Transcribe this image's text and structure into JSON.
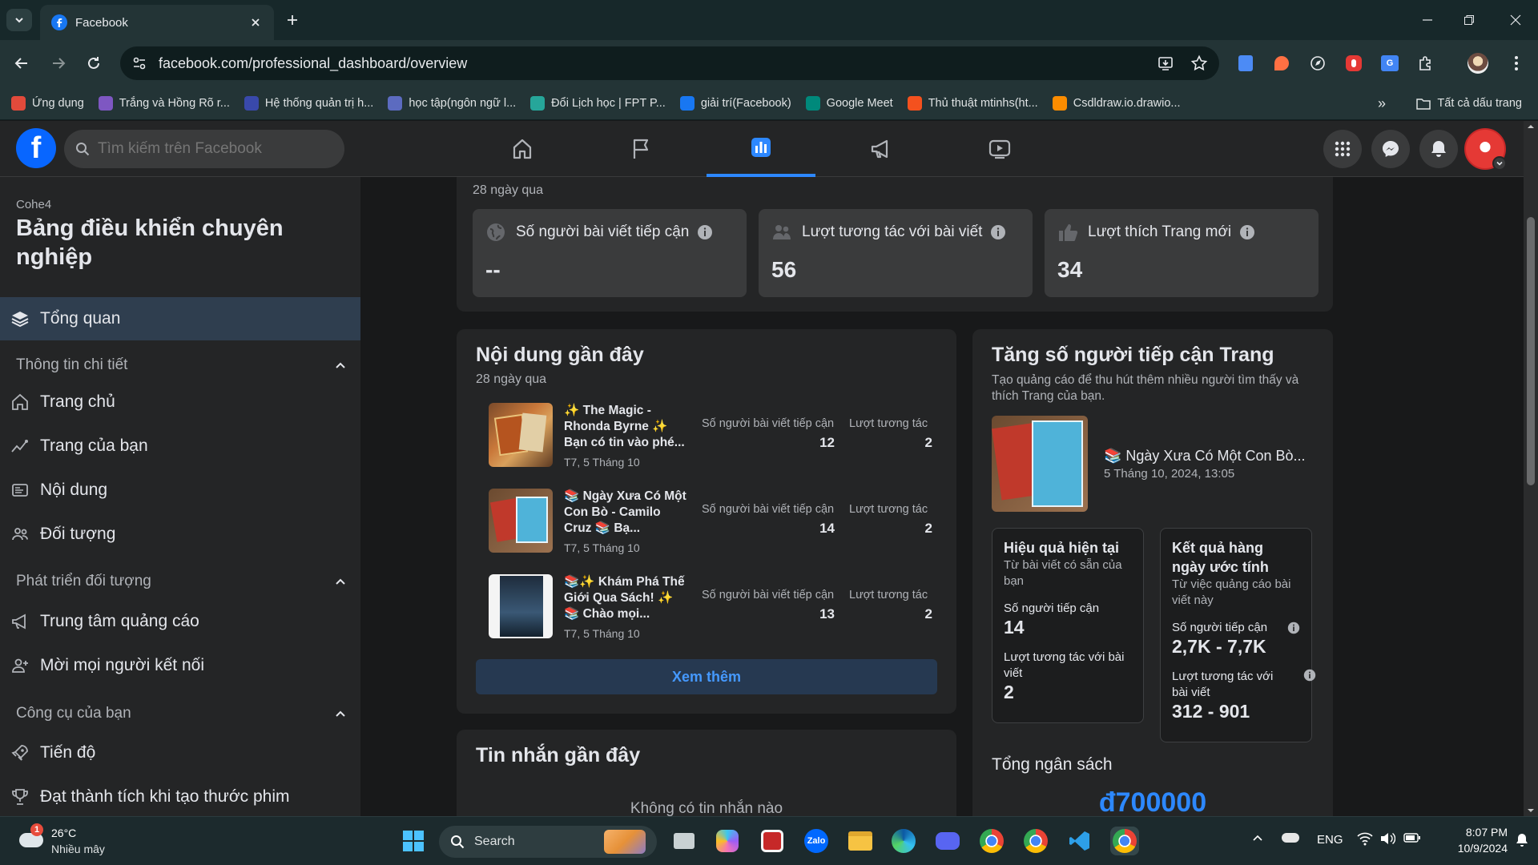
{
  "browser": {
    "tab_title": "Facebook",
    "url": "facebook.com/professional_dashboard/overview",
    "bookmarks": [
      {
        "label": "Ứng dụng",
        "color": "#e24a3b"
      },
      {
        "label": "Trắng và Hồng Rõ r...",
        "color": "#7e57c2"
      },
      {
        "label": "Hệ thống quản trị h...",
        "color": "#3949ab"
      },
      {
        "label": "học tập(ngôn ngữ l...",
        "color": "#5c6bc0"
      },
      {
        "label": "Đổi Lịch học | FPT P...",
        "color": "#26a69a"
      },
      {
        "label": "giải trí(Facebook)",
        "color": "#1877f2"
      },
      {
        "label": "Google Meet",
        "color": "#00897b"
      },
      {
        "label": "Thủ thuật mtinhs(ht...",
        "color": "#f4511e"
      },
      {
        "label": "Csdldraw.io.drawio...",
        "color": "#fb8c00"
      }
    ],
    "all_bookmarks": "Tất cả dấu trang"
  },
  "fb": {
    "logo": "f",
    "search_placeholder": "Tìm kiếm trên Facebook"
  },
  "sidebar": {
    "page_name": "Cohe4",
    "title": "Bảng điều khiển chuyên nghiệp",
    "overview": "Tổng quan",
    "sections": [
      {
        "label": "Thông tin chi tiết"
      },
      {
        "label": "Phát triển đối tượng"
      },
      {
        "label": "Công cụ của bạn"
      }
    ],
    "items": {
      "home": "Trang chủ",
      "your_page": "Trang của bạn",
      "content": "Nội dung",
      "audience": "Đối tượng",
      "ads_center": "Trung tâm quảng cáo",
      "invite": "Mời mọi người kết nối",
      "progress": "Tiến độ",
      "achievements": "Đạt thành tích khi tạo thước phim"
    }
  },
  "overview": {
    "period": "28 ngày qua",
    "stats": [
      {
        "label": "Số người bài viết tiếp cận",
        "value": "--"
      },
      {
        "label": "Lượt tương tác với bài viết",
        "value": "56"
      },
      {
        "label": "Lượt thích Trang mới",
        "value": "34"
      }
    ]
  },
  "recent_content": {
    "title": "Nội dung gần đây",
    "period": "28 ngày qua",
    "reach_label": "Số người bài viết tiếp cận",
    "engage_label": "Lượt tương tác",
    "posts": [
      {
        "text": "✨ The Magic - Rhonda Byrne ✨ Bạn có tin vào phé...",
        "date": "T7, 5 Tháng 10",
        "reach": "12",
        "engagement": "2"
      },
      {
        "text": "📚 Ngày Xưa Có Một Con Bò - Camilo Cruz 📚 Bạ...",
        "date": "T7, 5 Tháng 10",
        "reach": "14",
        "engagement": "2"
      },
      {
        "text": "📚✨ Khám Phá Thế Giới Qua Sách! ✨📚 Chào mọi...",
        "date": "T7, 5 Tháng 10",
        "reach": "13",
        "engagement": "2"
      }
    ],
    "see_more": "Xem thêm"
  },
  "recent_messages": {
    "title": "Tin nhắn gần đây",
    "empty": "Không có tin nhắn nào"
  },
  "boost": {
    "title": "Tăng số người tiếp cận Trang",
    "desc": "Tạo quảng cáo để thu hút thêm nhiều người tìm thấy và thích Trang của bạn.",
    "post_title": "📚 Ngày Xưa Có Một Con Bò...",
    "post_date": "5 Tháng 10, 2024, 13:05",
    "current": {
      "title": "Hiệu quả hiện tại",
      "sub": "Từ bài viết có sẵn của bạn",
      "reach_label": "Số người tiếp cận",
      "reach_value": "14",
      "engage_label": "Lượt tương tác với bài viết",
      "engage_value": "2"
    },
    "estimate": {
      "title": "Kết quả hàng ngày ước tính",
      "sub": "Từ việc quảng cáo bài viết này",
      "reach_label": "Số người tiếp cận",
      "reach_value": "2,7K - 7,7K",
      "engage_label": "Lượt tương tác với bài viết",
      "engage_value": "312 - 901"
    },
    "budget_title": "Tổng ngân sách",
    "budget_value": "đ700000"
  },
  "taskbar": {
    "temp": "26°C",
    "weather": "Nhiều mây",
    "search": "Search",
    "lang": "ENG",
    "time": "8:07 PM",
    "date": "10/9/2024",
    "weather_badge": "1"
  }
}
